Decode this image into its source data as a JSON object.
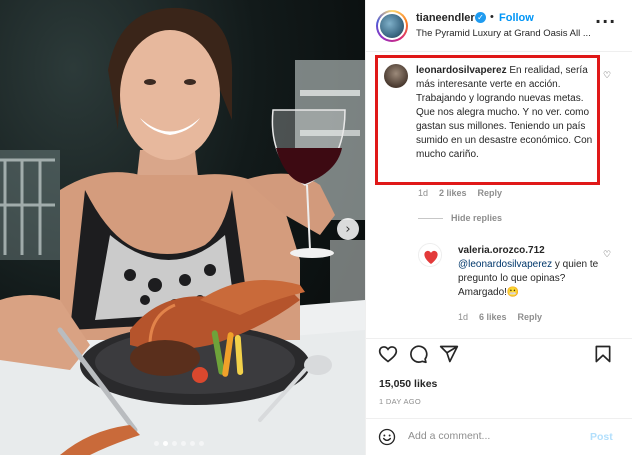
{
  "post": {
    "username": "tianeendler",
    "verified_glyph": "✓",
    "separator": "•",
    "follow_label": "Follow",
    "location": "The Pyramid Luxury at Grand Oasis All ...",
    "more_glyph": "···",
    "carousel_next_glyph": "›",
    "carousel_dots": 6,
    "carousel_active_index": 1,
    "likes": "15,050 likes",
    "time_ago": "1 DAY AGO"
  },
  "comments": [
    {
      "user": "leonardosilvaperez",
      "text": "En realidad, sería más interesante verte en acción. Trabajando y logrando nuevas metas. Que nos alegra mucho. Y no ver. como gastan sus millones. Teniendo un país sumido en un desastre económico. Con mucho cariño.",
      "time": "1d",
      "likes": "2 likes",
      "reply_label": "Reply",
      "hide_replies_label": "Hide replies"
    },
    {
      "user": "valeria.orozco.712",
      "mention": "@leonardosilvaperez",
      "text": " y quien te pregunto lo que opinas? Amargado!😬",
      "time": "1d",
      "likes": "6 likes",
      "reply_label": "Reply"
    }
  ],
  "actions": {
    "icons": [
      "heart-icon",
      "comment-icon",
      "share-icon",
      "bookmark-icon"
    ]
  },
  "composer": {
    "placeholder": "Add a comment...",
    "post_label": "Post",
    "emoji_icon": "emoji-icon"
  },
  "colors": {
    "accent": "#0095f6",
    "highlight_border": "#e01818",
    "muted": "#8e8e8e"
  }
}
